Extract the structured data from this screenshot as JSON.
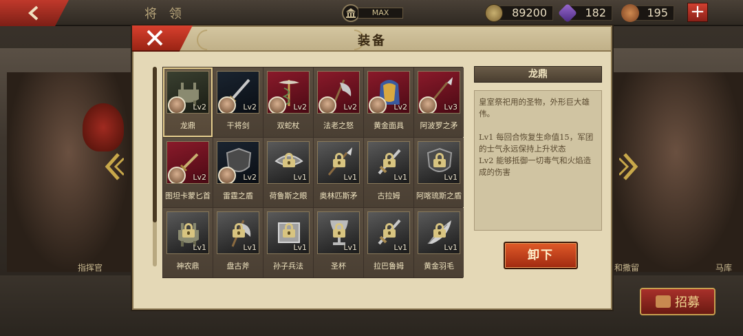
{
  "header": {
    "title": "将 领",
    "max_label": "MAX",
    "gold": "89200",
    "gems": "182",
    "food": "195",
    "plus_label": "+"
  },
  "background": {
    "left_hero_name": "指挥官",
    "right_hero_name_1": "和撒留",
    "right_hero_name_2": "马库",
    "recruit_label": "招募"
  },
  "dialog": {
    "title": "装备",
    "unequip_label": "卸下",
    "selected": {
      "name": "龙鼎",
      "description": "皇室祭祀用的圣物，外形巨大雄伟。",
      "effects": "Lv1  每回合恢复生命值15，军团的士气永远保持上升状态\nLv2  能够抵御一切毒气和火焰造成的伤害"
    },
    "items": [
      {
        "name": "龙鼎",
        "level": "Lv2",
        "state": "owned",
        "bg": "olive",
        "icon": "cauldron-icon"
      },
      {
        "name": "干将剑",
        "level": "Lv2",
        "state": "owned",
        "bg": "dark",
        "icon": "sword-icon"
      },
      {
        "name": "双蛇杖",
        "level": "Lv2",
        "state": "owned",
        "bg": "red",
        "icon": "caduceus-icon"
      },
      {
        "name": "法老之怒",
        "level": "Lv2",
        "state": "owned",
        "bg": "red",
        "icon": "axe-icon"
      },
      {
        "name": "黄金面具",
        "level": "Lv2",
        "state": "owned",
        "bg": "red",
        "icon": "pharaoh-mask-icon"
      },
      {
        "name": "阿波罗之矛",
        "level": "Lv3",
        "state": "owned",
        "bg": "red",
        "icon": "spear-icon"
      },
      {
        "name": "图坦卡蒙匕首",
        "level": "Lv2",
        "state": "owned",
        "bg": "red",
        "icon": "dagger-icon"
      },
      {
        "name": "雷霆之盾",
        "level": "Lv2",
        "state": "owned",
        "bg": "dark",
        "icon": "shield-icon"
      },
      {
        "name": "荷鲁斯之眼",
        "level": "Lv1",
        "state": "locked",
        "bg": "grey",
        "icon": "eye-of-horus-icon"
      },
      {
        "name": "奥林匹斯矛",
        "level": "Lv1",
        "state": "locked",
        "bg": "grey",
        "icon": "spear-icon"
      },
      {
        "name": "古拉姆",
        "level": "Lv1",
        "state": "locked",
        "bg": "grey",
        "icon": "sword-icon"
      },
      {
        "name": "阿喀琉斯之盾",
        "level": "Lv1",
        "state": "locked",
        "bg": "grey",
        "icon": "shield-icon"
      },
      {
        "name": "神农鼎",
        "level": "Lv1",
        "state": "locked",
        "bg": "grey",
        "icon": "cauldron-icon"
      },
      {
        "name": "盘古斧",
        "level": "Lv1",
        "state": "locked",
        "bg": "grey",
        "icon": "axe-icon"
      },
      {
        "name": "孙子兵法",
        "level": "Lv1",
        "state": "locked",
        "bg": "grey",
        "icon": "scroll-icon"
      },
      {
        "name": "圣杯",
        "level": "Lv1",
        "state": "locked",
        "bg": "grey",
        "icon": "chalice-icon"
      },
      {
        "name": "拉巴鲁姆",
        "level": "Lv1",
        "state": "locked",
        "bg": "grey",
        "icon": "sword-icon"
      },
      {
        "name": "黄金羽毛",
        "level": "Lv1",
        "state": "locked",
        "bg": "grey",
        "icon": "feather-icon"
      }
    ]
  },
  "colors": {
    "accent_red": "#c0392b",
    "parchment": "#e4d8b6",
    "unequip_orange": "#e05a28"
  }
}
